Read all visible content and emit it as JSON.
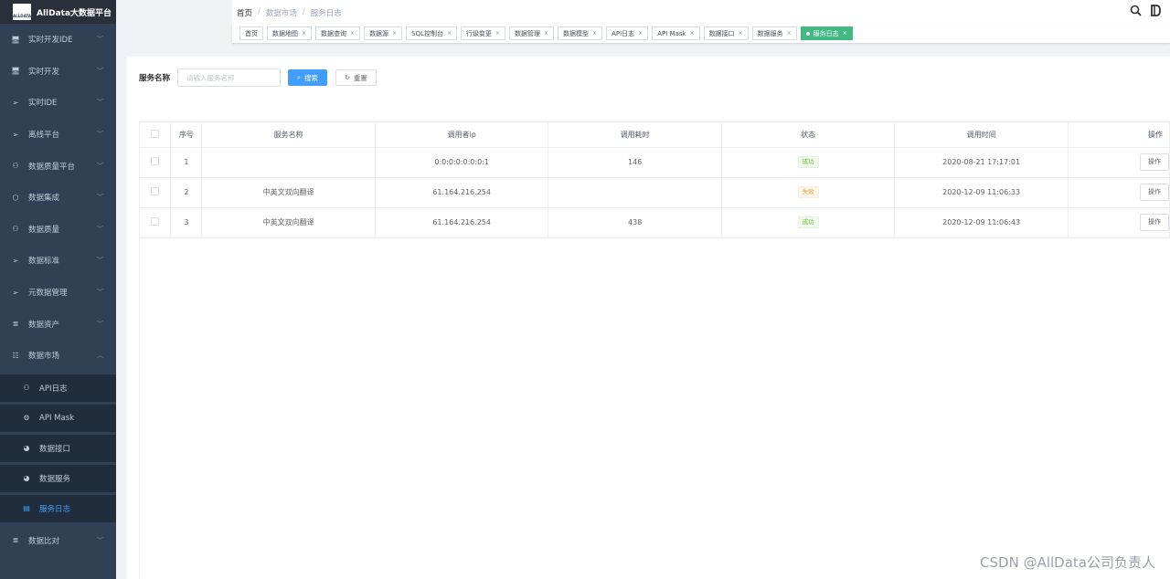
{
  "app": {
    "title": "AllData大数据平台",
    "logo_text": "ALLDATA"
  },
  "sidebar": {
    "items": [
      {
        "label": "实时开发IDE",
        "icon": "monitor-icon",
        "glyph": "🖥"
      },
      {
        "label": "实时开发",
        "icon": "monitor-icon",
        "glyph": "🖥"
      },
      {
        "label": "实时IDE",
        "icon": "send-icon",
        "glyph": "➢"
      },
      {
        "label": "离线平台",
        "icon": "send-icon",
        "glyph": "➢"
      },
      {
        "label": "数据质量平台",
        "icon": "user-icon",
        "glyph": "⚇"
      },
      {
        "label": "数据集成",
        "icon": "cube-icon",
        "glyph": "⬡"
      },
      {
        "label": "数据质量",
        "icon": "user-icon",
        "glyph": "⚇"
      },
      {
        "label": "数据标准",
        "icon": "send-icon",
        "glyph": "➢"
      },
      {
        "label": "元数据管理",
        "icon": "send-icon",
        "glyph": "➢"
      },
      {
        "label": "数据资产",
        "icon": "database-icon",
        "glyph": "≣"
      },
      {
        "label": "数据市场",
        "icon": "tree-icon",
        "glyph": "☷",
        "expanded": true
      }
    ],
    "sub_items": [
      {
        "label": "API日志",
        "icon": "user-icon",
        "glyph": "⚇"
      },
      {
        "label": "API Mask",
        "icon": "settings-icon",
        "glyph": "⚙"
      },
      {
        "label": "数据接口",
        "icon": "dashboard-icon",
        "glyph": "◕"
      },
      {
        "label": "数据服务",
        "icon": "dashboard-icon",
        "glyph": "◕"
      },
      {
        "label": "服务日志",
        "icon": "document-icon",
        "glyph": "▤",
        "active": true
      }
    ],
    "bottom_item": {
      "label": "数据比对",
      "icon": "database-icon",
      "glyph": "≣"
    }
  },
  "breadcrumb": {
    "home": "首页",
    "items": [
      "数据市场",
      "服务日志"
    ]
  },
  "header": {
    "search_icon": "search-icon",
    "doc_icon": "document-icon"
  },
  "tags": [
    {
      "label": "首页",
      "closable": false
    },
    {
      "label": "数据地图",
      "closable": true
    },
    {
      "label": "数据查询",
      "closable": true
    },
    {
      "label": "数据源",
      "closable": true
    },
    {
      "label": "SQL控制台",
      "closable": true
    },
    {
      "label": "行级变更",
      "closable": true
    },
    {
      "label": "数据管理",
      "closable": true
    },
    {
      "label": "数据模型",
      "closable": true
    },
    {
      "label": "API日志",
      "closable": true
    },
    {
      "label": "API Mask",
      "closable": true
    },
    {
      "label": "数据接口",
      "closable": true
    },
    {
      "label": "数据服务",
      "closable": true
    },
    {
      "label": "服务日志",
      "closable": true,
      "active": true
    }
  ],
  "search": {
    "label": "服务名称",
    "placeholder": "请输入服务名称",
    "value": "",
    "search_button": "搜索",
    "reset_button": "重置"
  },
  "table": {
    "columns": [
      "序号",
      "服务名称",
      "调用者ip",
      "调用耗时",
      "状态",
      "调用时间",
      "操作"
    ],
    "rows": [
      {
        "index": "1",
        "service": "",
        "ip": "0:0:0:0:0:0:0:1",
        "duration": "146",
        "status": "成功",
        "status_type": "ok",
        "time": "2020-08-21 17:17:01",
        "action": "操作"
      },
      {
        "index": "2",
        "service": "中英文双向翻译",
        "ip": "61.164.216.254",
        "duration": "",
        "status": "失败",
        "status_type": "fail",
        "time": "2020-12-09 11:06:33",
        "action": "操作"
      },
      {
        "index": "3",
        "service": "中英文双向翻译",
        "ip": "61.164.216.254",
        "duration": "438",
        "status": "成功",
        "status_type": "ok",
        "time": "2020-12-09 11:06:43",
        "action": "操作"
      }
    ]
  },
  "watermark": "CSDN @AllData公司负责人",
  "colors": {
    "sidebar_bg": "#304156",
    "primary": "#409eff",
    "tag_active": "#42b983",
    "success": "#67c23a",
    "warning": "#e6a23c"
  }
}
